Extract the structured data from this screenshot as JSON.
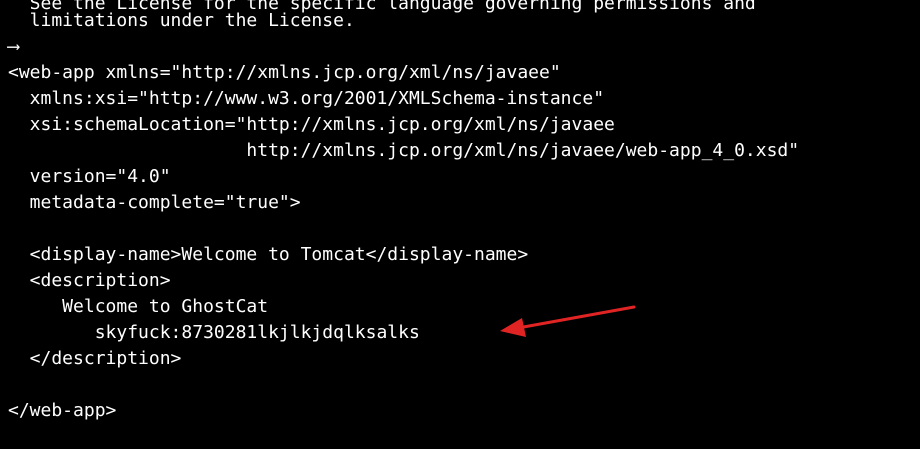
{
  "terminal": {
    "lines": [
      "  See the License for the specific language governing permissions and",
      "  limitations under the License.",
      "⟶",
      "<web-app xmlns=\"http://xmlns.jcp.org/xml/ns/javaee\"",
      "  xmlns:xsi=\"http://www.w3.org/2001/XMLSchema-instance\"",
      "  xsi:schemaLocation=\"http://xmlns.jcp.org/xml/ns/javaee",
      "                      http://xmlns.jcp.org/xml/ns/javaee/web-app_4_0.xsd\"",
      "  version=\"4.0\"",
      "  metadata-complete=\"true\">",
      "",
      "  <display-name>Welcome to Tomcat</display-name>",
      "  <description>",
      "     Welcome to GhostCat",
      "        skyfuck:8730281lkjlkjdqlksalks",
      "  </description>",
      "",
      "</web-app>"
    ]
  },
  "colors": {
    "background": "#000000",
    "text": "#ffffff",
    "annotation_arrow": "#e02424"
  }
}
